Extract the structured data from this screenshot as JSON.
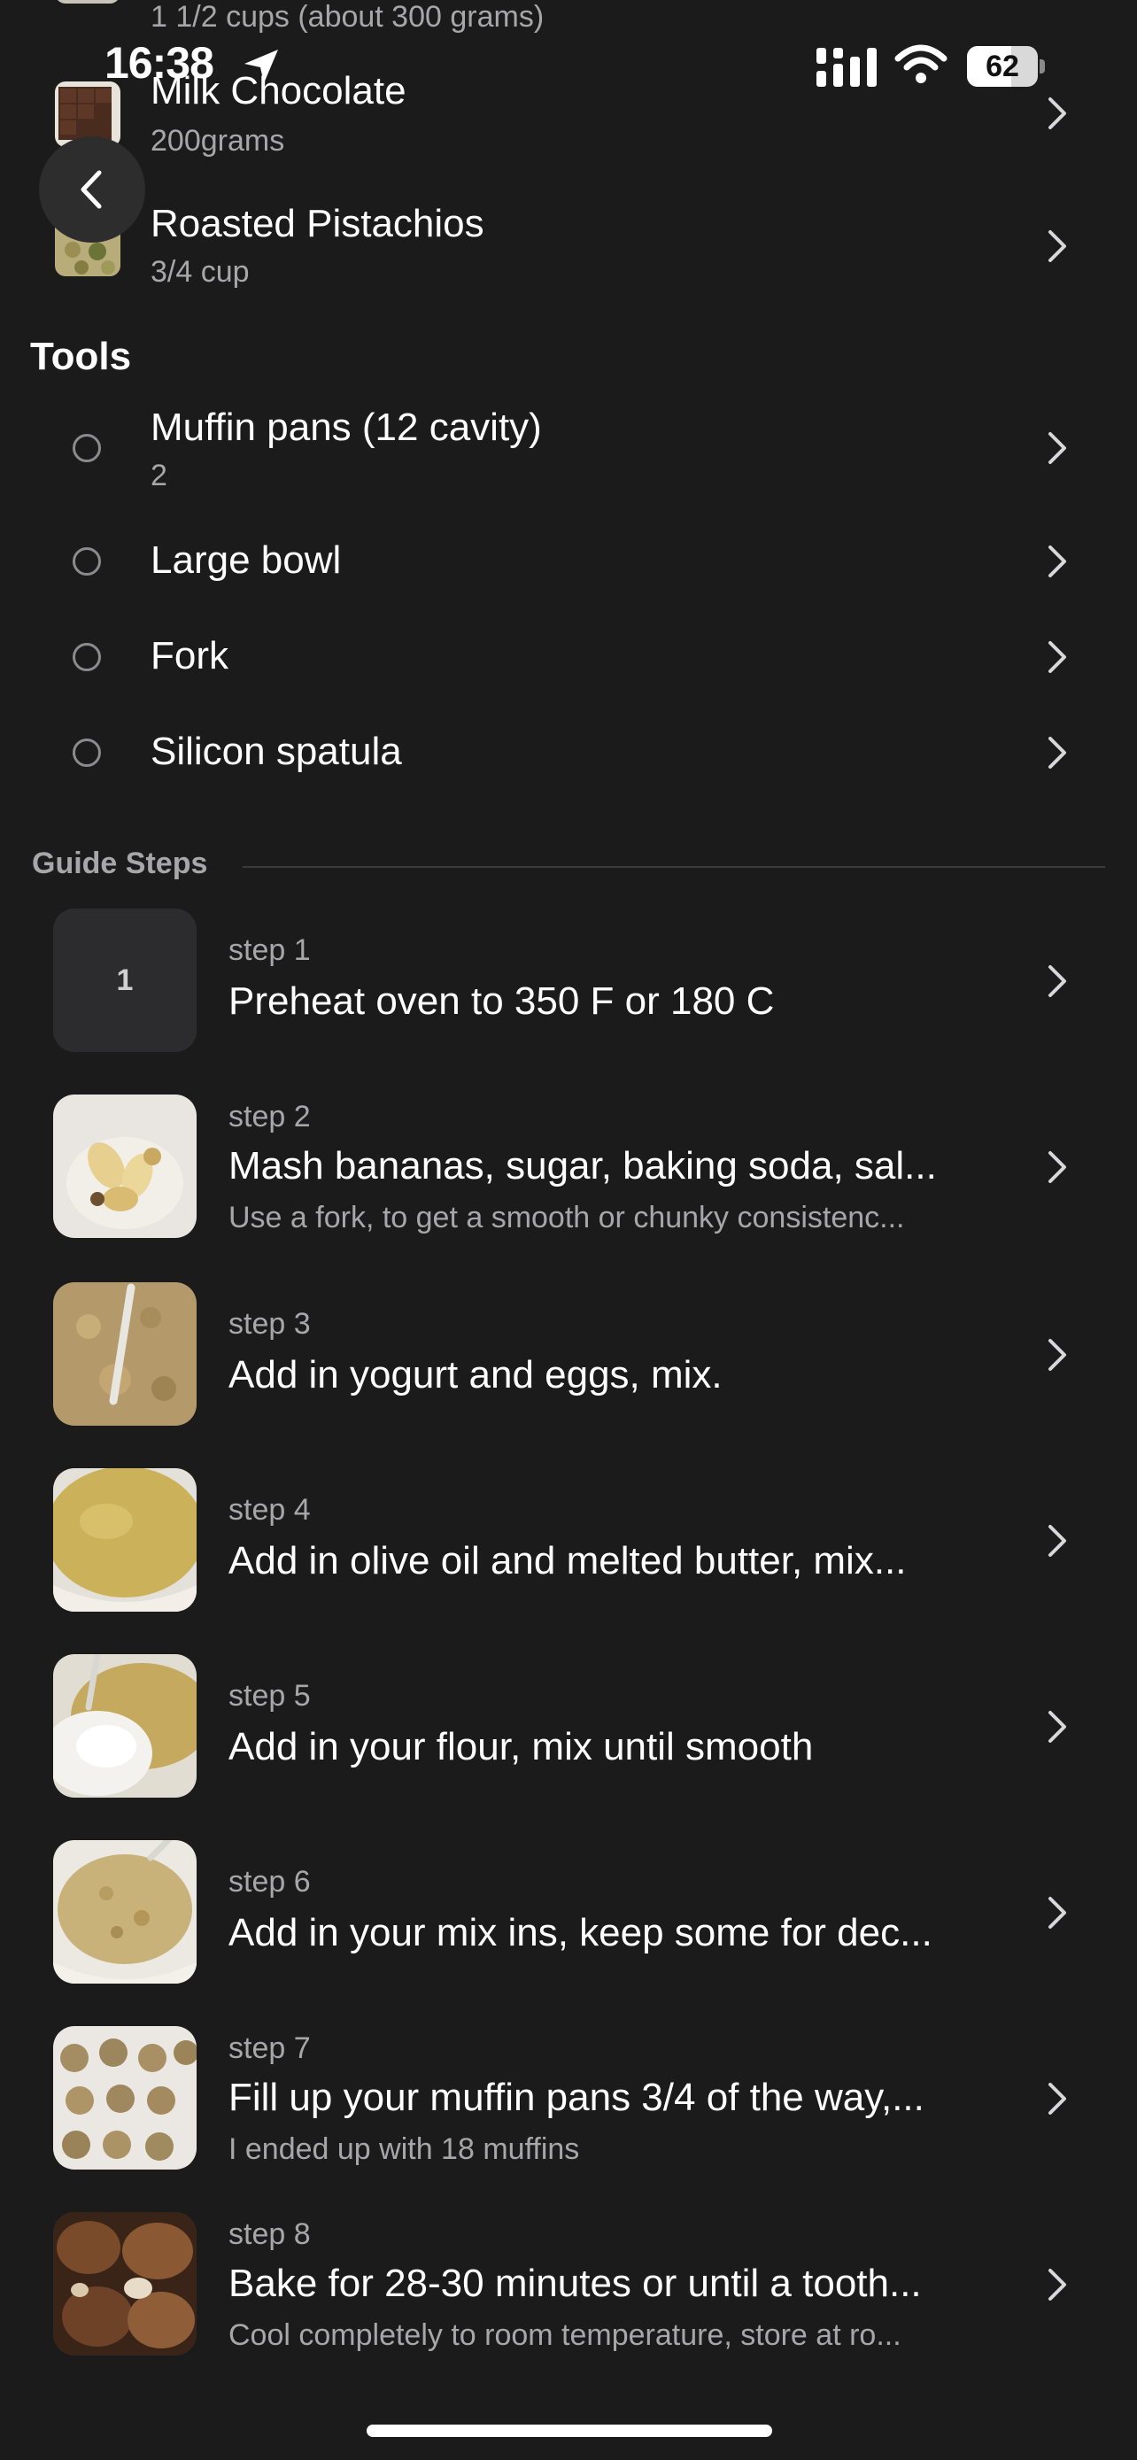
{
  "status_bar": {
    "time": "16:38",
    "battery": "62",
    "battery_level": 0.62
  },
  "ingredients": [
    {
      "title": "",
      "subtitle": "1 1/2 cups (about 300 grams)"
    },
    {
      "title": "Milk Chocolate",
      "subtitle": "200grams"
    },
    {
      "title": "Roasted Pistachios",
      "subtitle": "3/4 cup"
    }
  ],
  "tools": {
    "heading": "Tools",
    "items": [
      {
        "title": "Muffin pans (12 cavity)",
        "subtitle": "2"
      },
      {
        "title": "Large bowl"
      },
      {
        "title": "Fork"
      },
      {
        "title": "Silicon spatula"
      }
    ]
  },
  "guide": {
    "heading": "Guide Steps",
    "steps": [
      {
        "number": "1",
        "label": "step 1",
        "title": "Preheat oven to 350 F or 180 C",
        "note": ""
      },
      {
        "label": "step 2",
        "title": "Mash bananas, sugar, baking soda, sal...",
        "note": "Use a fork, to get a smooth or chunky consistenc..."
      },
      {
        "label": "step 3",
        "title": "Add in yogurt and eggs, mix.",
        "note": ""
      },
      {
        "label": "step 4",
        "title": "Add in olive oil and melted butter, mix...",
        "note": ""
      },
      {
        "label": "step 5",
        "title": "Add in your flour, mix until smooth",
        "note": ""
      },
      {
        "label": "step 6",
        "title": "Add in your mix ins, keep some for dec...",
        "note": ""
      },
      {
        "label": "step 7",
        "title": "Fill up your muffin pans 3/4 of the way,...",
        "note": "I ended up with 18 muffins"
      },
      {
        "label": "step 8",
        "title": "Bake for 28-30 minutes or until a tooth...",
        "note": "Cool completely to room temperature, store at ro..."
      }
    ]
  },
  "colors": {
    "background": "#1b1b1c",
    "muted_text": "#a7a7a9",
    "surface": "#2d2d2e"
  }
}
